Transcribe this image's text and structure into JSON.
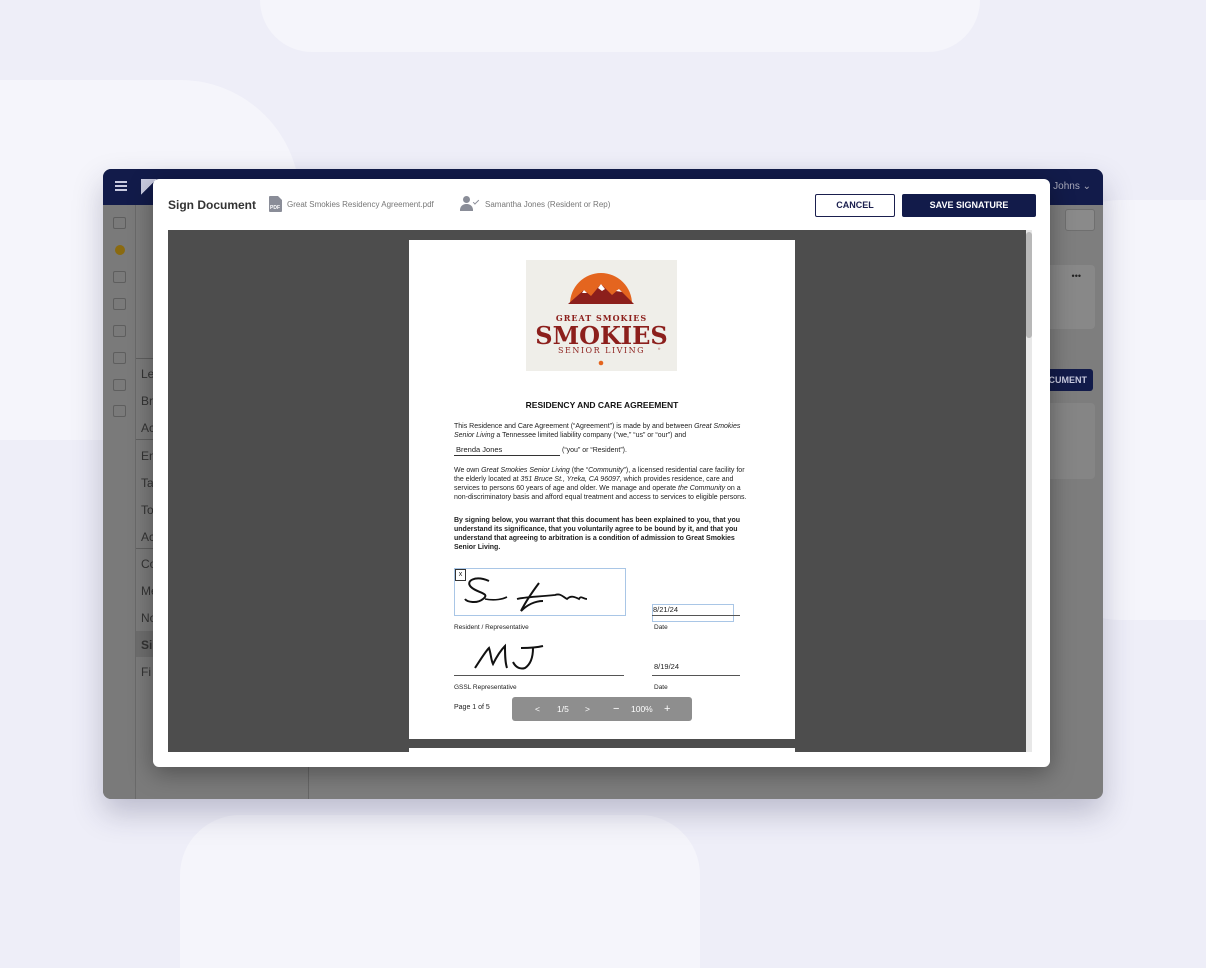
{
  "app": {
    "user_name": "e Johns",
    "panel_items": [
      "Le",
      "Br",
      "Ac",
      "En",
      "Ta",
      "To",
      "Ac",
      "Co",
      "Me",
      "No",
      "Si",
      "Fi"
    ],
    "partial_button": "CUMENT",
    "more_label": "•••"
  },
  "modal": {
    "title": "Sign Document",
    "file_name": "Great Smokies Residency Agreement.pdf",
    "file_type": "PDF",
    "signer": "Samantha Jones (Resident or Rep)",
    "cancel_label": "CANCEL",
    "save_label": "SAVE SIGNATURE"
  },
  "document": {
    "logo": {
      "line1": "GREAT SMOKIES",
      "line2": "SMOKIES",
      "line3": "SENIOR LIVING"
    },
    "title": "RESIDENCY AND CARE AGREEMENT",
    "para1_pre": "This Residence and Care Agreement (“Agreement”) is made by and between ",
    "para1_em": "Great Smokies Senior Living",
    "para1_post": " a Tennessee limited liability company (“we,” “us” or “our”) and",
    "resident_name": "Brenda Jones",
    "resident_suffix": "(“you” or “Resident”).",
    "para2_a": "We own ",
    "para2_em1": "Great Smokies Senior Living",
    "para2_b": " (the “",
    "para2_em2": "Community",
    "para2_c": "”), a licensed residential care facility for the elderly located at ",
    "para2_em3": "351 Bruce St., Yreka, CA 96097",
    "para2_d": ", which provides residence, care and services to persons 60 years of age and older. We manage and operate ",
    "para2_em4": "the Community",
    "para2_e": " on a non-discriminatory basis and afford equal treatment and access to services to eligible persons.",
    "para3": "By signing below, you warrant that this document has been explained to you, that you understand its significance, that you voluntarily agree to be bound by it, and that you understand that agreeing to arbitration is a condition of admission to Great Smokies Senior Living.",
    "sig_clear": "x",
    "sig1_label": "Resident / Representative",
    "date1_value": "8/21/24",
    "date1_label": "Date",
    "sig2_label": "GSSL Representative",
    "date2_value": "8/19/24",
    "date2_label": "Date",
    "page_count": "Page 1 of 5"
  },
  "pager": {
    "prev": "<",
    "current": "1/5",
    "next": ">",
    "zoom_out": "−",
    "zoom": "100%",
    "zoom_in": "+"
  },
  "colors": {
    "navy": "#121b4a",
    "logo_orange": "#e4651f",
    "logo_red": "#8c1f1c"
  }
}
